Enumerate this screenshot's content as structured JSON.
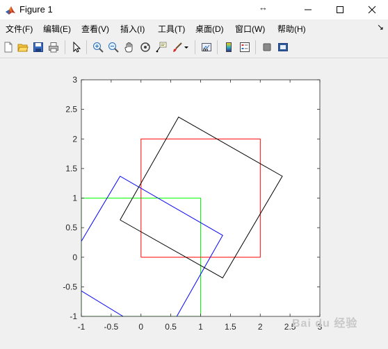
{
  "window": {
    "title": "Figure 1",
    "resize_glyph": "↔"
  },
  "menu": {
    "items": [
      {
        "label": "文件(F)"
      },
      {
        "label": "编辑(E)"
      },
      {
        "label": "查看(V)"
      },
      {
        "label": "插入(I)"
      },
      {
        "label": "工具(T)"
      },
      {
        "label": "桌面(D)"
      },
      {
        "label": "窗口(W)"
      },
      {
        "label": "帮助(H)"
      }
    ],
    "overflow_arrow": "↘"
  },
  "toolbar": {
    "buttons": [
      {
        "icon": "new-figure-icon"
      },
      {
        "icon": "open-file-icon"
      },
      {
        "icon": "save-icon"
      },
      {
        "icon": "print-icon"
      },
      {
        "icon": "pointer-icon"
      },
      {
        "icon": "zoom-in-icon"
      },
      {
        "icon": "zoom-out-icon"
      },
      {
        "icon": "pan-icon"
      },
      {
        "icon": "rotate-3d-icon"
      },
      {
        "icon": "data-cursor-icon"
      },
      {
        "icon": "brush-icon"
      },
      {
        "icon": "link-plot-icon"
      },
      {
        "icon": "colorbar-icon"
      },
      {
        "icon": "legend-icon"
      },
      {
        "icon": "hide-plot-tools-icon"
      },
      {
        "icon": "show-plot-tools-icon"
      }
    ]
  },
  "watermark": "Bai du 经验",
  "chart_data": {
    "type": "line",
    "title": "",
    "xlabel": "",
    "ylabel": "",
    "xlim": [
      -1,
      3
    ],
    "ylim": [
      -1,
      3
    ],
    "xticks": [
      "-1",
      "-0.5",
      "0",
      "0.5",
      "1",
      "1.5",
      "2",
      "2.5",
      "3"
    ],
    "yticks": [
      "-1",
      "-0.5",
      "0",
      "0.5",
      "1",
      "1.5",
      "2",
      "2.5",
      "3"
    ],
    "grid": false,
    "series": [
      {
        "color": "#00ff00",
        "x": [
          -1,
          1,
          1,
          -1,
          -1
        ],
        "y": [
          -1,
          -1,
          1,
          1,
          -1
        ]
      },
      {
        "color": "#ff0000",
        "x": [
          0,
          2,
          2,
          0,
          0
        ],
        "y": [
          0,
          0,
          2,
          2,
          0
        ]
      },
      {
        "color": "#0000ff",
        "x": [
          -1,
          -0.35,
          1.37,
          -1,
          -1
        ],
        "y": [
          0.27,
          1.37,
          0.37,
          -0.57,
          0.27
        ],
        "segments": [
          [
            [
              -1,
              0.27
            ],
            [
              -0.35,
              1.37
            ],
            [
              1.37,
              0.37
            ],
            [
              0.6,
              -1
            ]
          ],
          [
            [
              -1,
              -0.57
            ],
            [
              -0.3,
              -1
            ]
          ]
        ]
      },
      {
        "color": "#000000",
        "x": [
          -0.35,
          0.63,
          2.37,
          1.37,
          -0.35
        ],
        "y": [
          0.63,
          2.37,
          1.37,
          -0.35,
          0.63
        ]
      }
    ]
  }
}
